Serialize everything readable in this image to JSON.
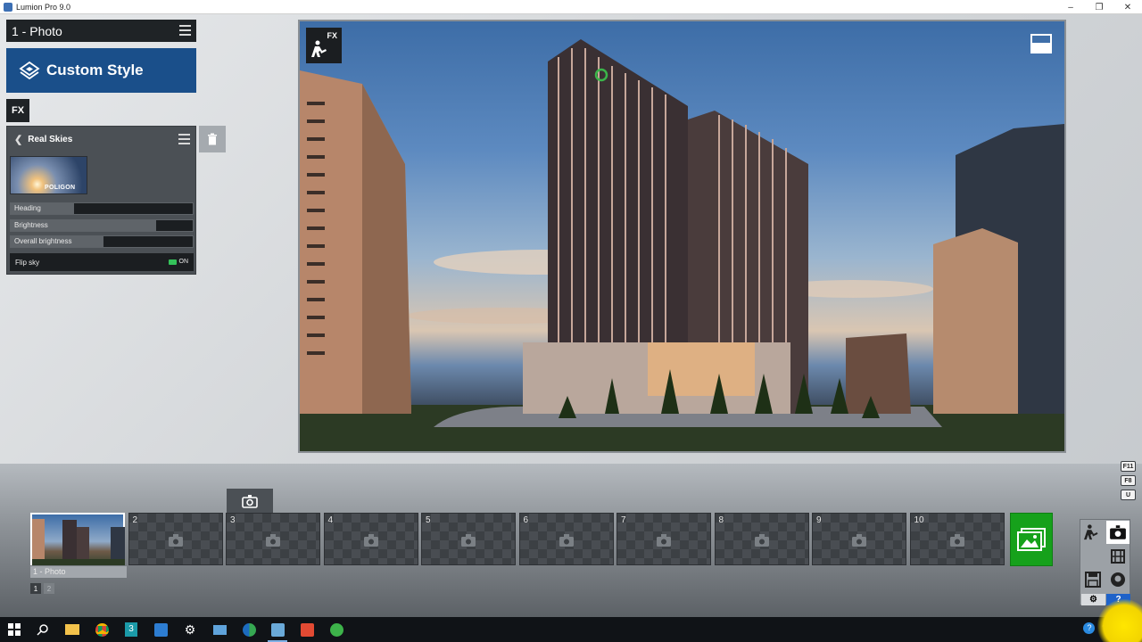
{
  "window": {
    "title": "Lumion Pro 9.0"
  },
  "left_panel": {
    "photo_title": "1 - Photo",
    "style_button": "Custom Style",
    "fx_tab": "FX",
    "effect": {
      "title": "Real Skies",
      "thumbnail_brand": "POLIGON",
      "sliders": [
        {
          "label": "Heading",
          "fill_percent": 35
        },
        {
          "label": "Brightness",
          "fill_percent": 80
        },
        {
          "label": "Overall brightness",
          "fill_percent": 51
        }
      ],
      "toggle": {
        "label": "Flip sky",
        "state": "ON"
      }
    }
  },
  "viewport": {
    "fx_badge": "FX"
  },
  "timeline": {
    "slots": [
      {
        "number": "",
        "caption": "1 - Photo",
        "active": true
      },
      {
        "number": "2"
      },
      {
        "number": "3"
      },
      {
        "number": "4"
      },
      {
        "number": "5"
      },
      {
        "number": "6"
      },
      {
        "number": "7"
      },
      {
        "number": "8"
      },
      {
        "number": "9"
      },
      {
        "number": "10"
      }
    ],
    "pages": [
      "1",
      "2"
    ]
  },
  "shortcut_keys": [
    "F11",
    "F8",
    "U"
  ],
  "mode_panel": {
    "help": "?"
  },
  "colors": {
    "accent_blue": "#1a4f8a",
    "render_green": "#16a11b",
    "toggle_on": "#34c25a"
  }
}
